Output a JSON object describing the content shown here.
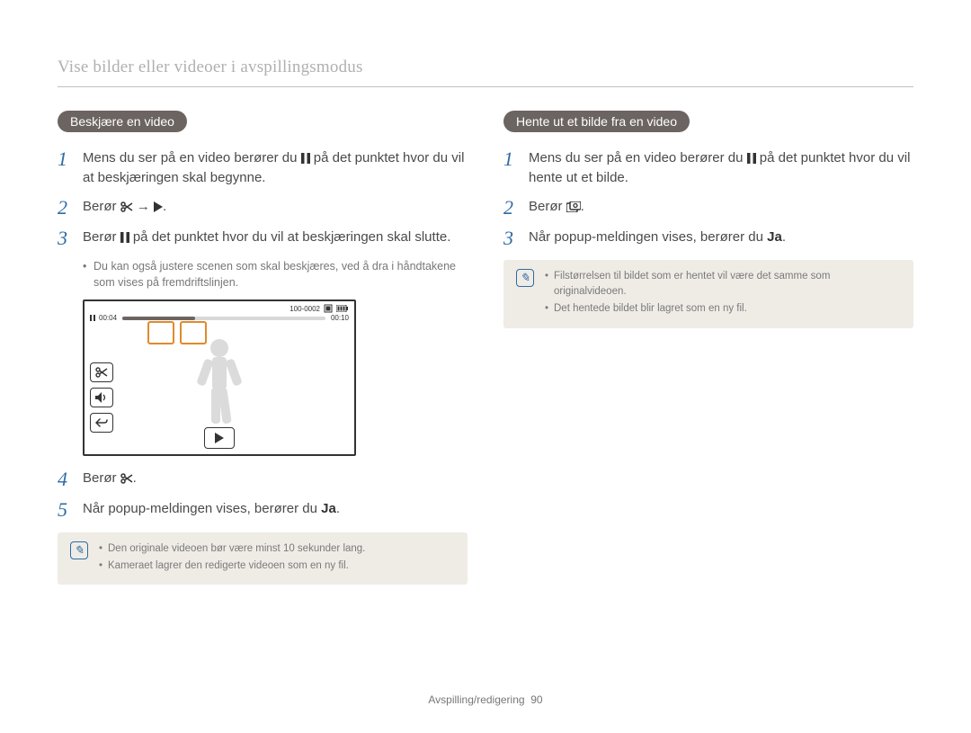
{
  "page_title": "Vise bilder eller videoer i avspillingsmodus",
  "left": {
    "heading": "Beskjære en video",
    "steps": {
      "s1_a": "Mens du ser på en video berører du ",
      "s1_b": " på det punktet hvor du vil at beskjæringen skal begynne.",
      "s2_a": "Berør ",
      "s2_arrow": " → ",
      "s2_b": ".",
      "s3_a": "Berør ",
      "s3_b": " på det punktet hvor du vil at beskjæringen skal slutte.",
      "s3_sub1": "Du kan også justere scenen som skal beskjæres, ved å dra i håndtakene som vises på fremdriftslinjen.",
      "s4_a": "Berør ",
      "s4_b": ".",
      "s5_a": "Når popup-meldingen vises, berører du ",
      "s5_bold": "Ja",
      "s5_b": "."
    },
    "note": {
      "n1": "Den originale videoen bør være minst 10 sekunder lang.",
      "n2": "Kameraet lagrer den redigerte videoen som en ny fil."
    },
    "mock": {
      "file_label": "100-0002",
      "time_current": "00:04",
      "time_total": "00:10"
    }
  },
  "right": {
    "heading": "Hente ut et bilde fra en video",
    "steps": {
      "s1_a": "Mens du ser på en video berører du ",
      "s1_b": " på det punktet hvor du vil hente ut et bilde.",
      "s2_a": "Berør ",
      "s2_b": ".",
      "s3_a": "Når popup-meldingen vises, berører du ",
      "s3_bold": "Ja",
      "s3_b": "."
    },
    "note": {
      "n1": "Filstørrelsen til bildet som er hentet vil være det samme som originalvideoen.",
      "n2": "Det hentede bildet blir lagret som en ny fil."
    }
  },
  "footer": {
    "section": "Avspilling/redigering",
    "page": "90"
  }
}
